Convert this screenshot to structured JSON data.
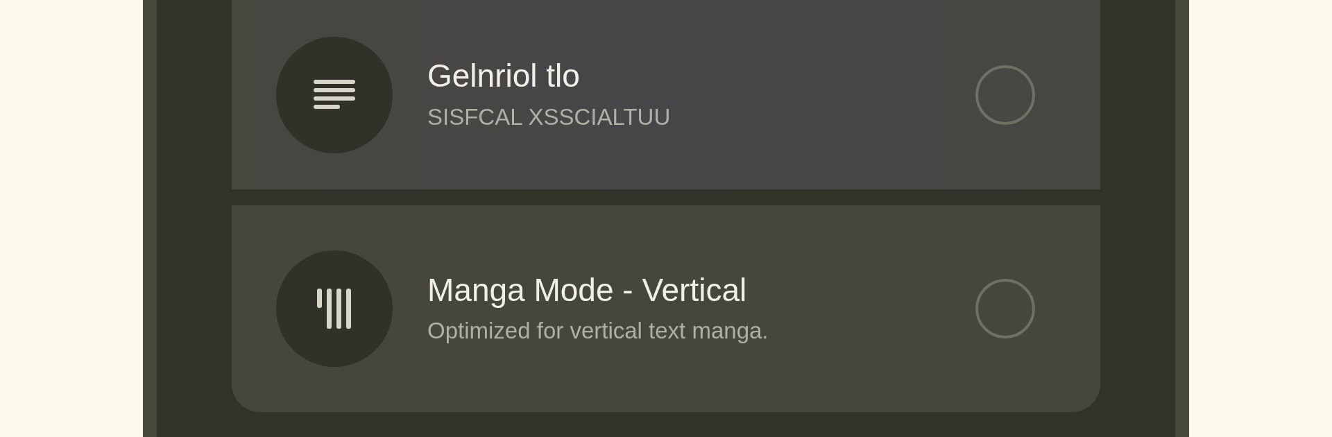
{
  "options": [
    {
      "kind": "lines",
      "title": "Gelnriol tlo",
      "subtitle": "SISFCAL XSSCIALTUU",
      "selected": false
    },
    {
      "kind": "vertical",
      "title": "Manga Mode - Vertical",
      "subtitle": "Optimized for vertical text manga.",
      "selected": false
    }
  ]
}
